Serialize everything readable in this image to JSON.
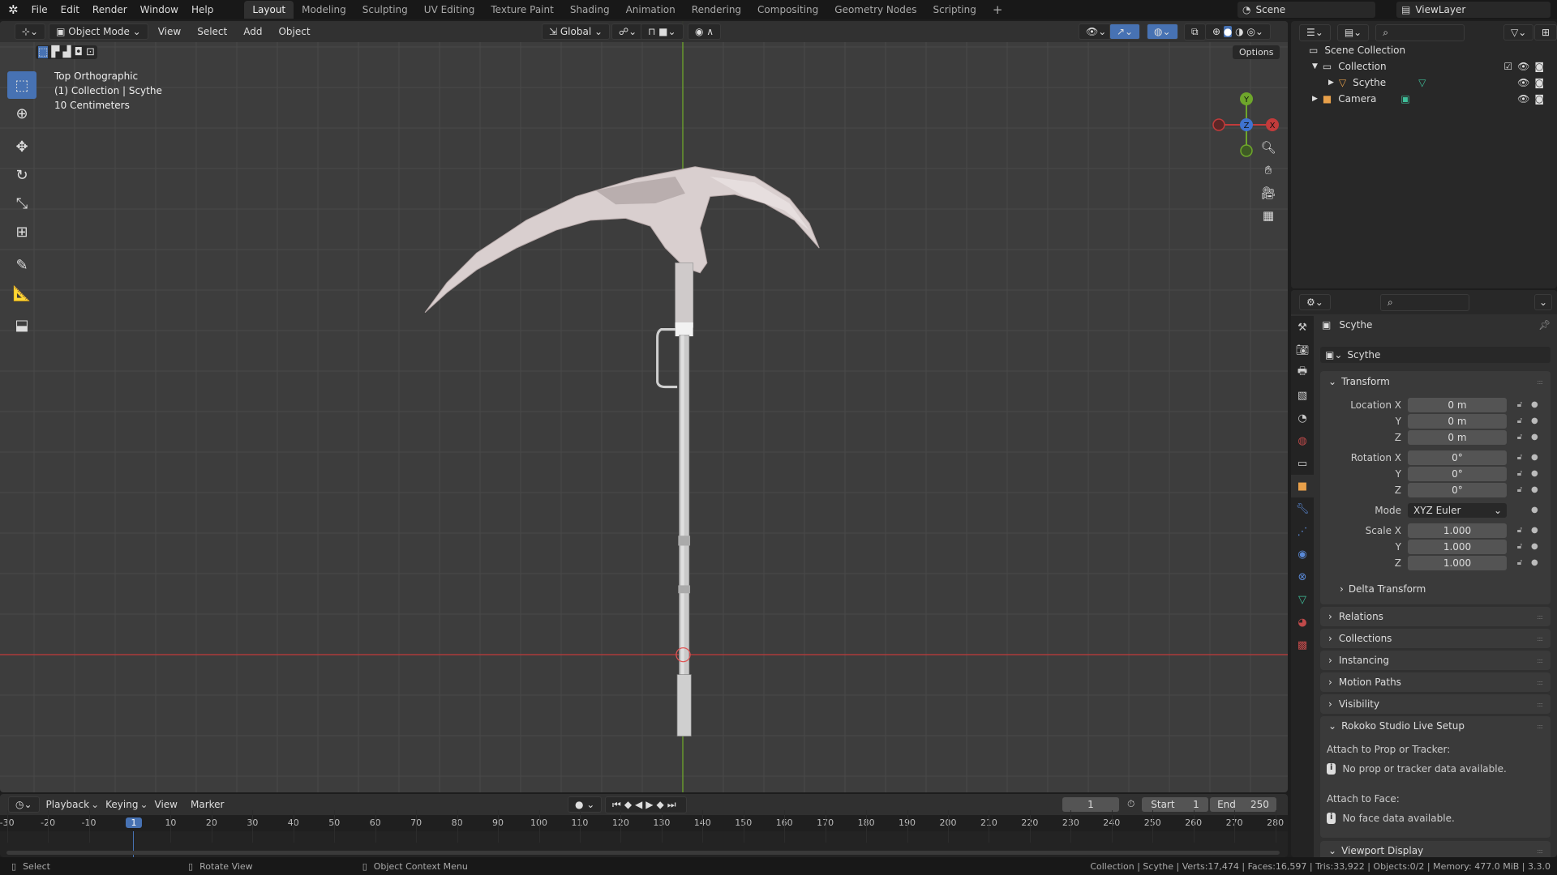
{
  "topbar": {
    "menus": [
      "File",
      "Edit",
      "Render",
      "Window",
      "Help"
    ],
    "workspaces": [
      "Layout",
      "Modeling",
      "Sculpting",
      "UV Editing",
      "Texture Paint",
      "Shading",
      "Animation",
      "Rendering",
      "Compositing",
      "Geometry Nodes",
      "Scripting"
    ],
    "active_workspace": "Layout",
    "add_tab": "+",
    "scene": "Scene",
    "view_layer": "ViewLayer"
  },
  "viewport": {
    "mode": "Object Mode",
    "menus": [
      "View",
      "Select",
      "Add",
      "Object"
    ],
    "orientation": "Global",
    "options": "Options",
    "overlay": [
      "Top Orthographic",
      "(1) Collection | Scythe",
      "10 Centimeters"
    ],
    "gizmo": {
      "y": "Y",
      "z": "Z",
      "x": "X"
    },
    "colors": {
      "x_axis": "#c23b3b",
      "y_axis": "#6ea62b",
      "accent": "#4772b3"
    }
  },
  "outliner": {
    "items": [
      {
        "label": "Scene Collection",
        "icon": "collection-icon"
      },
      {
        "label": "Collection",
        "icon": "collection-icon"
      },
      {
        "label": "Scythe",
        "icon": "mesh-object-icon"
      },
      {
        "label": "Camera",
        "icon": "camera-icon"
      }
    ]
  },
  "properties": {
    "object_name": "Scythe",
    "datablock": "Scythe",
    "transform": {
      "title": "Transform",
      "location_label": "Location X",
      "location": [
        "0 m",
        "0 m",
        "0 m"
      ],
      "rotation_label": "Rotation X",
      "rotation": [
        "0°",
        "0°",
        "0°"
      ],
      "mode_label": "Mode",
      "mode": "XYZ Euler",
      "scale_label": "Scale X",
      "scale": [
        "1.000",
        "1.000",
        "1.000"
      ],
      "axis_y": "Y",
      "axis_z": "Z",
      "delta": "Delta Transform"
    },
    "panels": [
      "Relations",
      "Collections",
      "Instancing",
      "Motion Paths",
      "Visibility"
    ],
    "rokoko": {
      "title": "Rokoko Studio Live Setup",
      "prop_label": "Attach to Prop or Tracker:",
      "prop_msg": "No prop or tracker data available.",
      "face_label": "Attach to Face:",
      "face_msg": "No face data available."
    },
    "viewport_display": "Viewport Display"
  },
  "timeline": {
    "menus": [
      "Playback",
      "Keying",
      "View",
      "Marker"
    ],
    "current_frame": "1",
    "start_label": "Start",
    "start": "1",
    "end_label": "End",
    "end": "250",
    "ticks": [
      "-30",
      "-20",
      "-10",
      "1",
      "10",
      "20",
      "30",
      "40",
      "50",
      "60",
      "70",
      "80",
      "90",
      "100",
      "110",
      "120",
      "130",
      "140",
      "150",
      "160",
      "170",
      "180",
      "190",
      "200",
      "210",
      "220",
      "230",
      "240",
      "250",
      "260",
      "270",
      "280"
    ]
  },
  "statusbar": {
    "select": "Select",
    "rotate": "Rotate View",
    "context": "Object Context Menu",
    "stats": "Collection | Scythe | Verts:17,474 | Faces:16,597 | Tris:33,922 | Objects:0/2 | Memory: 477.0 MiB | 3.3.0"
  }
}
